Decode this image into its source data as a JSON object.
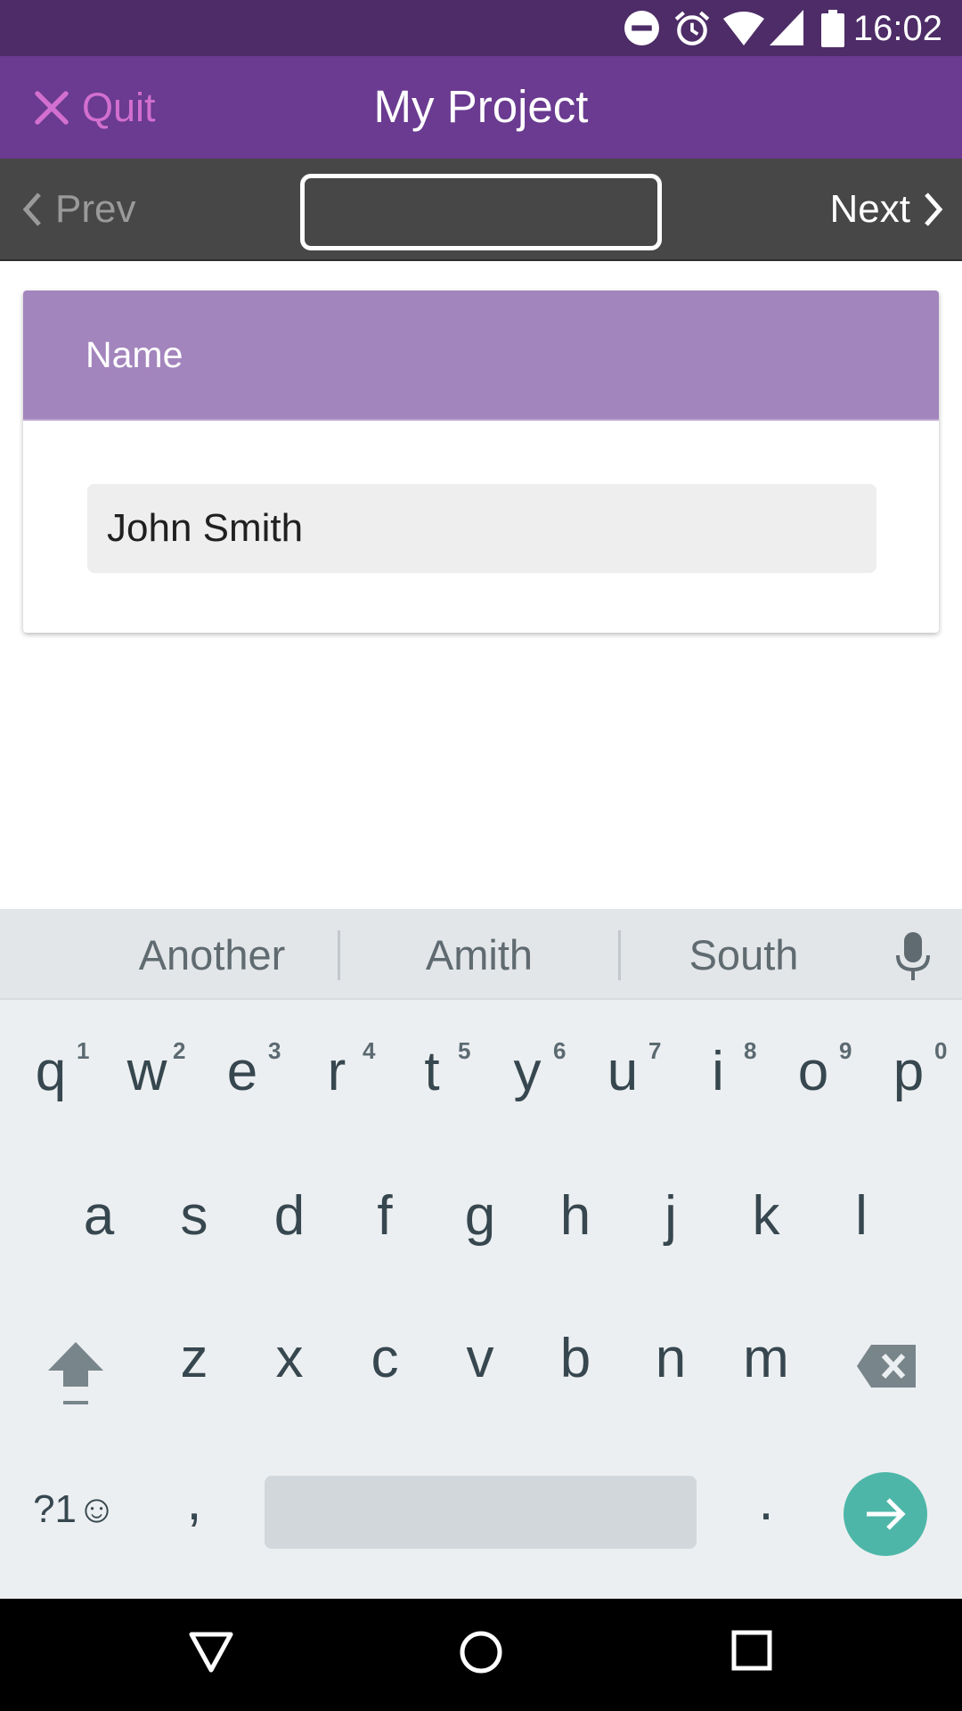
{
  "status_bar": {
    "time": "16:02",
    "icons": [
      "do-not-disturb-icon",
      "alarm-icon",
      "wifi-icon",
      "cell-signal-icon",
      "battery-icon"
    ]
  },
  "app_bar": {
    "quit_label": "Quit",
    "title": "My Project"
  },
  "nav_bar": {
    "prev_label": "Prev",
    "next_label": "Next",
    "page_indicator": ""
  },
  "form": {
    "field_label": "Name",
    "field_value": "John Smith"
  },
  "keyboard": {
    "suggestions": [
      "Another",
      "Amith",
      "South"
    ],
    "row1": [
      {
        "key": "q",
        "hint": "1"
      },
      {
        "key": "w",
        "hint": "2"
      },
      {
        "key": "e",
        "hint": "3"
      },
      {
        "key": "r",
        "hint": "4"
      },
      {
        "key": "t",
        "hint": "5"
      },
      {
        "key": "y",
        "hint": "6"
      },
      {
        "key": "u",
        "hint": "7"
      },
      {
        "key": "i",
        "hint": "8"
      },
      {
        "key": "o",
        "hint": "9"
      },
      {
        "key": "p",
        "hint": "0"
      }
    ],
    "row2": [
      "a",
      "s",
      "d",
      "f",
      "g",
      "h",
      "j",
      "k",
      "l"
    ],
    "row3": [
      "z",
      "x",
      "c",
      "v",
      "b",
      "n",
      "m"
    ],
    "symbols_label": "?1☺",
    "comma": ",",
    "period": "."
  },
  "colors": {
    "status_bar": "#4d2c67",
    "app_bar": "#6a3b90",
    "quit_accent": "#d26fcf",
    "nav_bar": "#474747",
    "card_header": "#a385bd",
    "enter_key": "#4db6a8"
  }
}
